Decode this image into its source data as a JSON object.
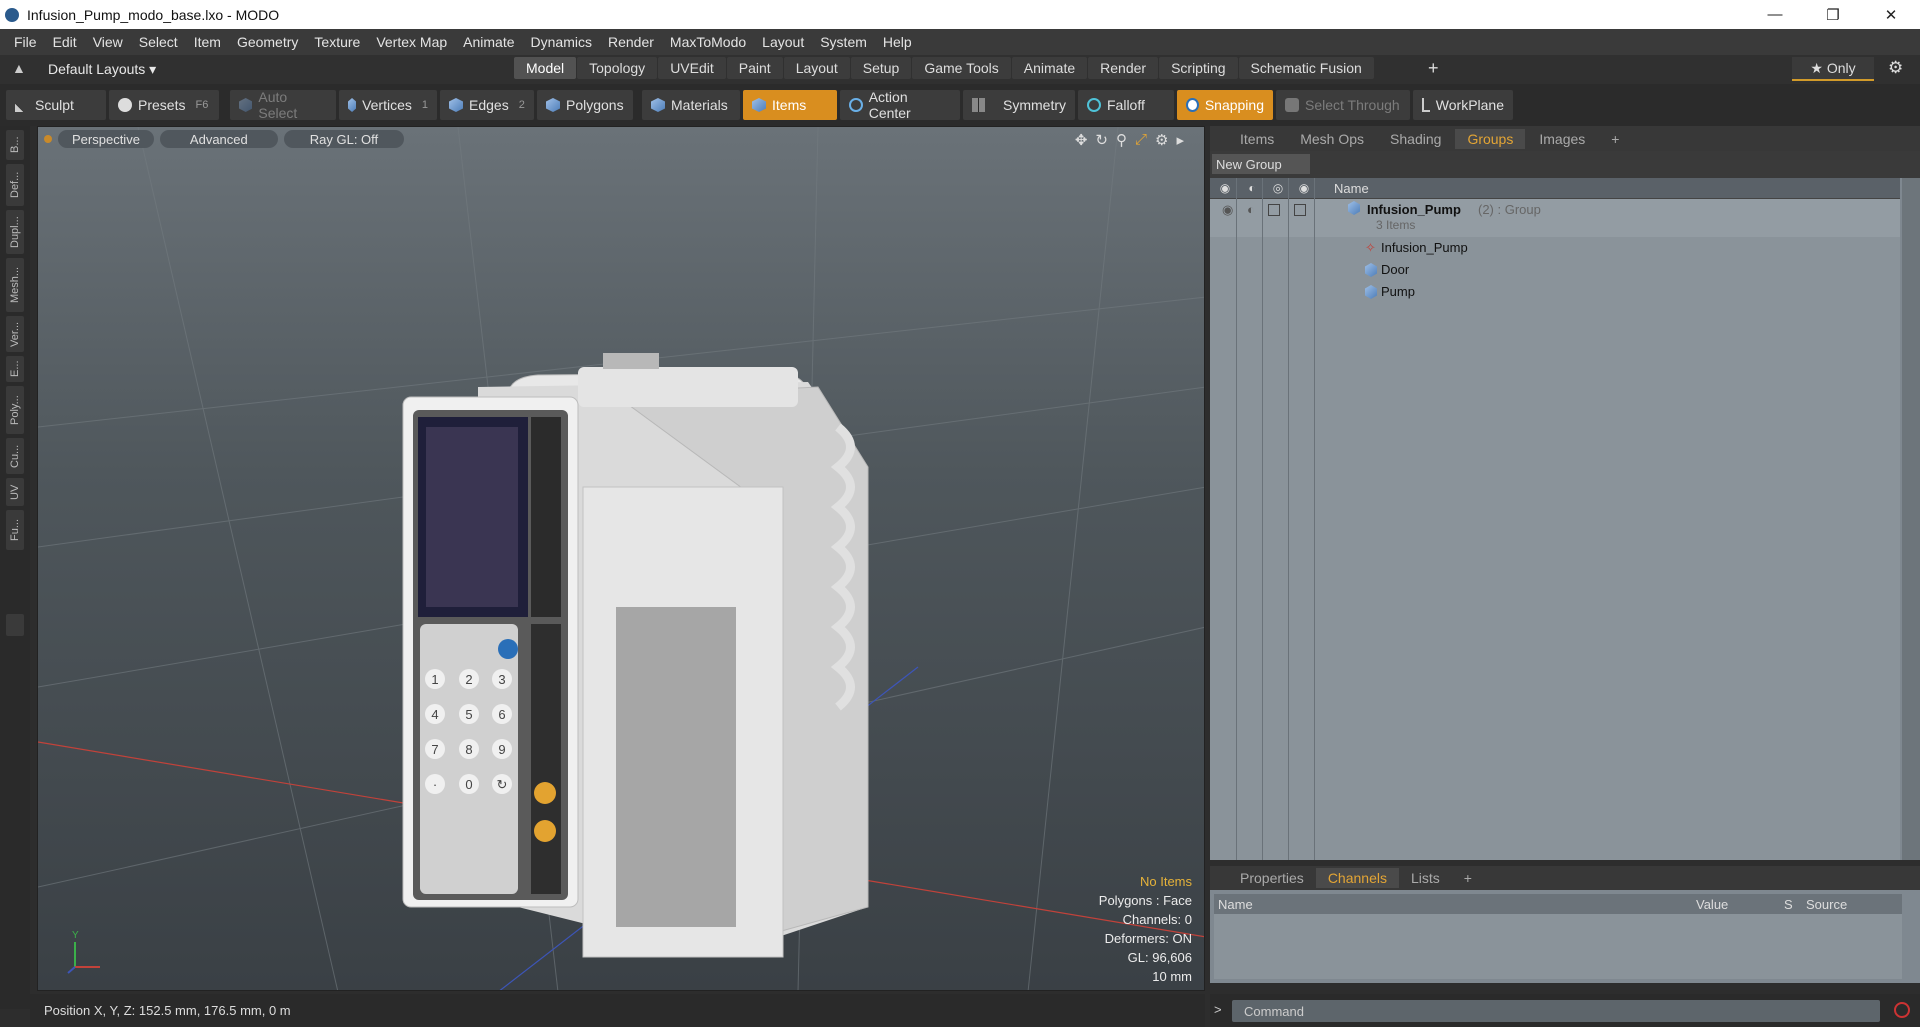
{
  "window": {
    "title": "Infusion_Pump_modo_base.lxo - MODO",
    "controls": [
      "—",
      "❐",
      "✕"
    ]
  },
  "menu": [
    "File",
    "Edit",
    "View",
    "Select",
    "Item",
    "Geometry",
    "Texture",
    "Vertex Map",
    "Animate",
    "Dynamics",
    "Render",
    "MaxToModo",
    "Layout",
    "System",
    "Help"
  ],
  "layout": {
    "dropdown": "Default Layouts ▾",
    "tabs": [
      "Model",
      "Topology",
      "UVEdit",
      "Paint",
      "Layout",
      "Setup",
      "Game Tools",
      "Animate",
      "Render",
      "Scripting",
      "Schematic Fusion"
    ],
    "active_tab": "Model",
    "plus": "+",
    "only": "★ Only",
    "gear": "⚙"
  },
  "toolbar": {
    "sculpt": "Sculpt",
    "presets": "Presets",
    "presets_key": "F6",
    "auto_select": "Auto Select",
    "vertices": "Vertices",
    "vertices_count": "1",
    "edges": "Edges",
    "edges_count": "2",
    "polygons": "Polygons",
    "materials": "Materials",
    "items": "Items",
    "action_center": "Action Center",
    "symmetry": "Symmetry",
    "falloff": "Falloff",
    "snapping": "Snapping",
    "select_through": "Select Through",
    "workplane": "WorkPlane"
  },
  "left_tabs": [
    "B...",
    "Def...",
    "Dupl...",
    "Mesh...",
    "Ver...",
    "E...",
    "Poly...",
    "Cu...",
    "UV",
    "Fu..."
  ],
  "viewport": {
    "perspective": "Perspective",
    "advanced": "Advanced",
    "raygl": "Ray GL: Off",
    "stats": {
      "selection": "No Items",
      "polygons": "Polygons : Face",
      "channels": "Channels: 0",
      "deformers": "Deformers: ON",
      "gl": "GL: 96,606",
      "scale": "10 mm"
    },
    "axis": {
      "y": "Y"
    },
    "keypad": [
      "1",
      "2",
      "3",
      "4",
      "5",
      "6",
      "7",
      "8",
      "9",
      "·",
      "0",
      "↻"
    ]
  },
  "right_panel": {
    "tabs": [
      "Items",
      "Mesh Ops",
      "Shading",
      "Groups",
      "Images"
    ],
    "active_tab": "Groups",
    "plus": "+",
    "new_group": "New Group",
    "name_header": "Name",
    "tree": [
      {
        "label": "Infusion_Pump",
        "extra": "(2) : Group",
        "sub": "3 Items"
      },
      {
        "label": "Infusion_Pump"
      },
      {
        "label": "Door"
      },
      {
        "label": "Pump"
      }
    ]
  },
  "bottom_panel": {
    "tabs": [
      "Properties",
      "Channels",
      "Lists"
    ],
    "active_tab": "Channels",
    "plus": "+",
    "columns": [
      "Name",
      "Value",
      "S",
      "Source"
    ]
  },
  "status": {
    "position": "Position X, Y, Z:   152.5 mm, 176.5 mm, 0 m"
  },
  "command": {
    "placeholder": "Command",
    "arrow": ">"
  },
  "colors": {
    "accent": "#d98e1f",
    "tab_active": "#e3a535"
  }
}
